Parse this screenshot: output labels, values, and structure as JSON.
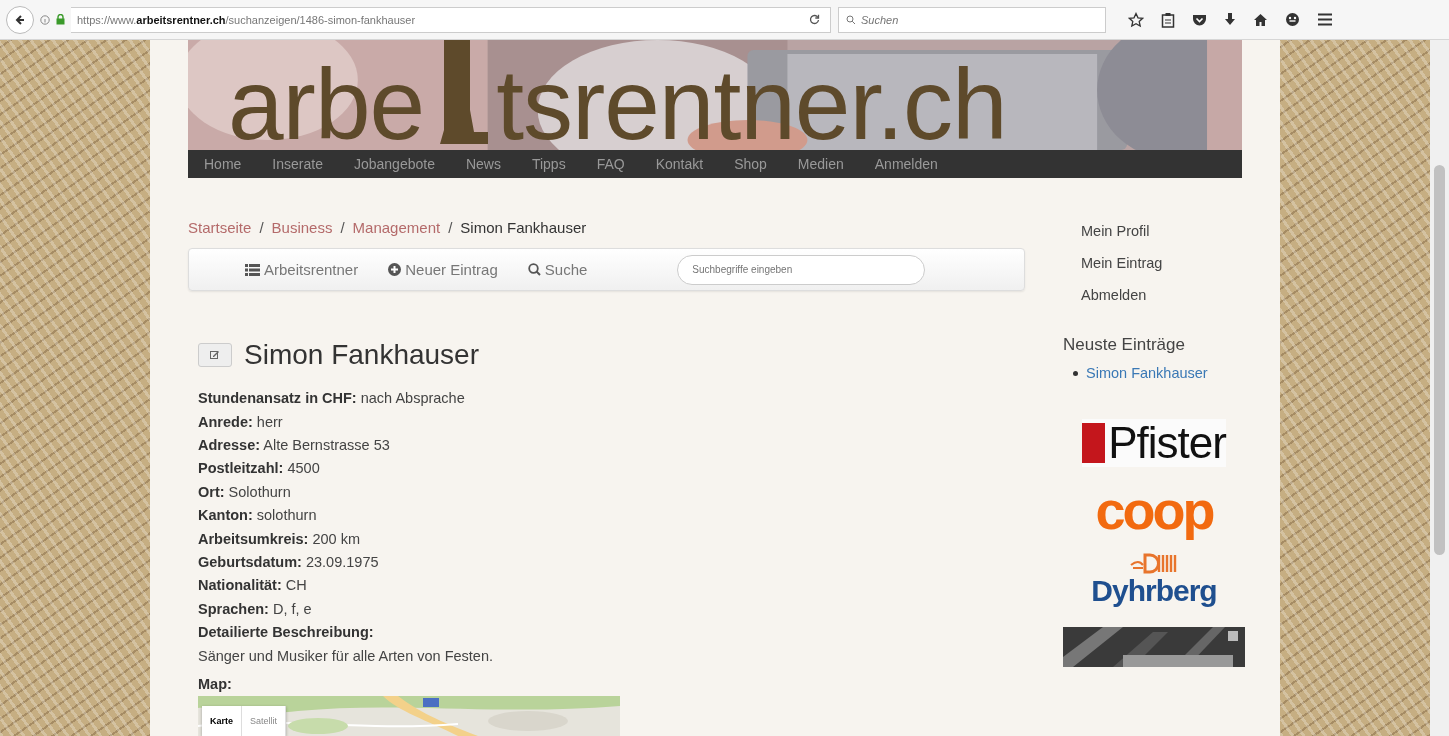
{
  "browser": {
    "url": "https://www.**arbeitsrentner.ch**/suchanzeigen/1486-simon-fankhauser",
    "search_placeholder": "Suchen"
  },
  "banner": {
    "logo_start": "arbe",
    "logo_end": "tsrentner.ch"
  },
  "nav": [
    "Home",
    "Inserate",
    "Jobangebote",
    "News",
    "Tipps",
    "FAQ",
    "Kontakt",
    "Shop",
    "Medien",
    "Anmelden"
  ],
  "breadcrumb_separator": "/",
  "breadcrumb": [
    {
      "label": "Startseite",
      "kind": "link"
    },
    {
      "label": "Business",
      "kind": "link"
    },
    {
      "label": "Management",
      "kind": "link"
    },
    {
      "label": "Simon Fankhauser",
      "kind": "current"
    }
  ],
  "toolbar": {
    "items": [
      {
        "label": "Arbeitsrentner",
        "kind": "list"
      },
      {
        "label": "Neuer Eintrag",
        "kind": "create"
      },
      {
        "label": "Suche",
        "kind": "search"
      }
    ],
    "search_placeholder": "Suchbegriffe eingeben"
  },
  "entry": {
    "title": "Simon Fankhauser",
    "fields": [
      {
        "label": "Stundenansatz in CHF:",
        "value": "nach Absprache"
      },
      {
        "label": "Anrede:",
        "value": "herr"
      },
      {
        "label": "Adresse:",
        "value": "Alte Bernstrasse 53"
      },
      {
        "label": "Postleitzahl:",
        "value": "4500"
      },
      {
        "label": "Ort:",
        "value": "Solothurn"
      },
      {
        "label": "Kanton:",
        "value": "solothurn"
      },
      {
        "label": "Arbeitsumkreis:",
        "value": "200 km"
      },
      {
        "label": "Geburtsdatum:",
        "value": "23.09.1975"
      },
      {
        "label": "Nationalität:",
        "value": "CH"
      },
      {
        "label": "Sprachen:",
        "value": "D, f, e"
      }
    ],
    "description_label": "Detailierte Beschreibung:",
    "description": "Sänger und Musiker für alle Arten von Festen.",
    "map_label": "Map:",
    "map_buttons": [
      {
        "label": "Karte",
        "selected": true
      },
      {
        "label": "Satellit",
        "selected": false
      }
    ]
  },
  "sidebar": {
    "user_links": [
      "Mein Profil",
      "Mein Eintrag",
      "Abmelden"
    ],
    "recent_title": "Neuste Einträge",
    "recent": [
      "Simon Fankhauser"
    ],
    "sponsors": [
      {
        "kind": "pfister",
        "name": "Pfister"
      },
      {
        "kind": "coop",
        "name": "coop"
      },
      {
        "kind": "dyhrberg",
        "name": "Dyhrberg"
      },
      {
        "kind": "picture"
      }
    ]
  }
}
